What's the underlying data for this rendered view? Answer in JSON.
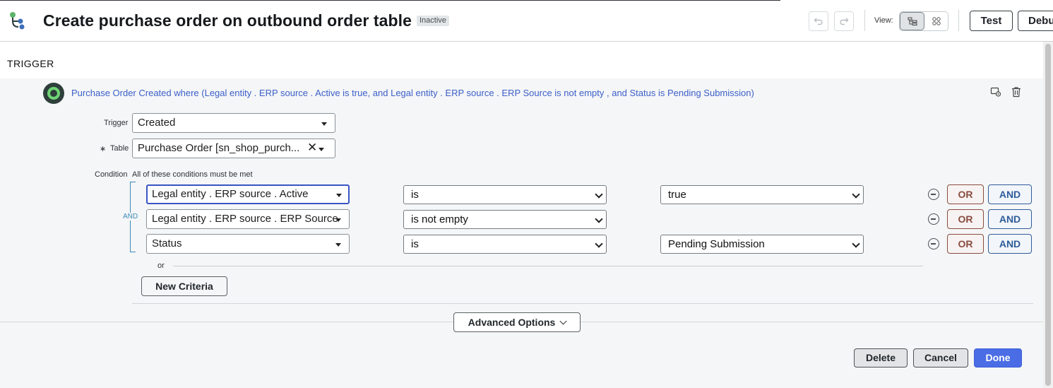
{
  "header": {
    "title": "Create purchase order on outbound order table",
    "status_badge": "Inactive",
    "view_label": "View:",
    "test_label": "Test",
    "debug_label": "Debu"
  },
  "trigger": {
    "section_title": "TRIGGER",
    "summary": "Purchase Order Created where (Legal entity . ERP source . Active is true, and Legal entity . ERP source . ERP Source is not empty , and Status is Pending Submission)",
    "trigger_label": "Trigger",
    "trigger_value": "Created",
    "table_required_mark": "∗",
    "table_label": "Table",
    "table_value": "Purchase Order [sn_shop_purch...",
    "condition_label": "Condition",
    "condition_hint": "All of these conditions must be met",
    "and_group_label": "AND",
    "conditions": [
      {
        "field": "Legal entity . ERP source . Active",
        "operator": "is",
        "value": "true"
      },
      {
        "field": "Legal entity . ERP source . ERP Source",
        "operator": "is not empty",
        "value": ""
      },
      {
        "field": "Status",
        "operator": "is",
        "value": "Pending Submission"
      }
    ],
    "or_button_label": "OR",
    "and_button_label": "AND",
    "or_separator": "or",
    "new_criteria_label": "New Criteria",
    "advanced_options_label": "Advanced Options"
  },
  "footer": {
    "delete_label": "Delete",
    "cancel_label": "Cancel",
    "done_label": "Done"
  },
  "colors": {
    "accent": "#4a6de5",
    "link_blue": "#3b5fc9",
    "or_color": "#8a4b3f",
    "and_color": "#2f5d99",
    "trigger_green": "#6fd474"
  }
}
